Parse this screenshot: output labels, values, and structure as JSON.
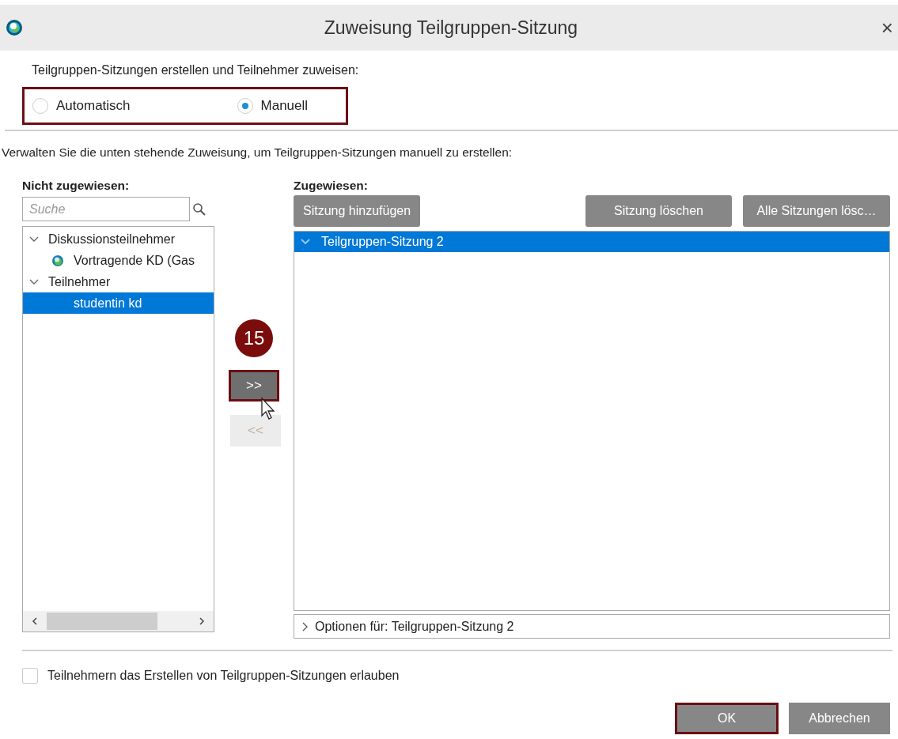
{
  "window": {
    "title": "Zuweisung Teilgruppen-Sitzung",
    "close": "×"
  },
  "mode": {
    "label": "Teilgruppen-Sitzungen erstellen und Teilnehmer zuweisen:",
    "highlighted": true,
    "options": [
      {
        "label": "Automatisch",
        "selected": false
      },
      {
        "label": "Manuell",
        "selected": true
      }
    ]
  },
  "instruction": "Verwalten Sie die unten stehende Zuweisung, um Teilgruppen-Sitzungen manuell zu erstellen:",
  "unassigned": {
    "heading": "Nicht zugewiesen:",
    "search": {
      "placeholder": "Suche"
    },
    "tree": [
      {
        "label": "Diskussionsteilnehmer",
        "expanded": true,
        "selected": false,
        "children": [
          {
            "label": "Vortragende KD (Gas",
            "selected": false,
            "kind": "presenter"
          }
        ]
      },
      {
        "label": "Teilnehmer",
        "expanded": true,
        "selected": false,
        "children": [
          {
            "label": "studentin kd",
            "selected": true,
            "kind": "attendee"
          }
        ]
      }
    ]
  },
  "step_badge": "15",
  "move_buttons": [
    {
      "label": ">>",
      "disabled": false,
      "highlighted": true
    },
    {
      "label": "<<",
      "disabled": true,
      "highlighted": false
    }
  ],
  "assigned": {
    "heading": "Zugewiesen:",
    "buttons": [
      {
        "label": "Sitzung hinzufügen"
      },
      {
        "label": "Sitzung löschen"
      },
      {
        "label": "Alle Sitzungen lösc…"
      }
    ],
    "sessions": [
      {
        "label": "Teilgruppen-Sitzung 2",
        "expanded": true,
        "selected": true
      }
    ],
    "options": {
      "label": "Optionen für: Teilgruppen-Sitzung 2",
      "expanded": false
    }
  },
  "allow": {
    "label": "Teilnehmern das Erstellen von Teilgruppen-Sitzungen erlauben",
    "checked": false
  },
  "footer_buttons": [
    {
      "label": "OK",
      "highlighted": true
    },
    {
      "label": "Abbrechen",
      "highlighted": false
    }
  ]
}
